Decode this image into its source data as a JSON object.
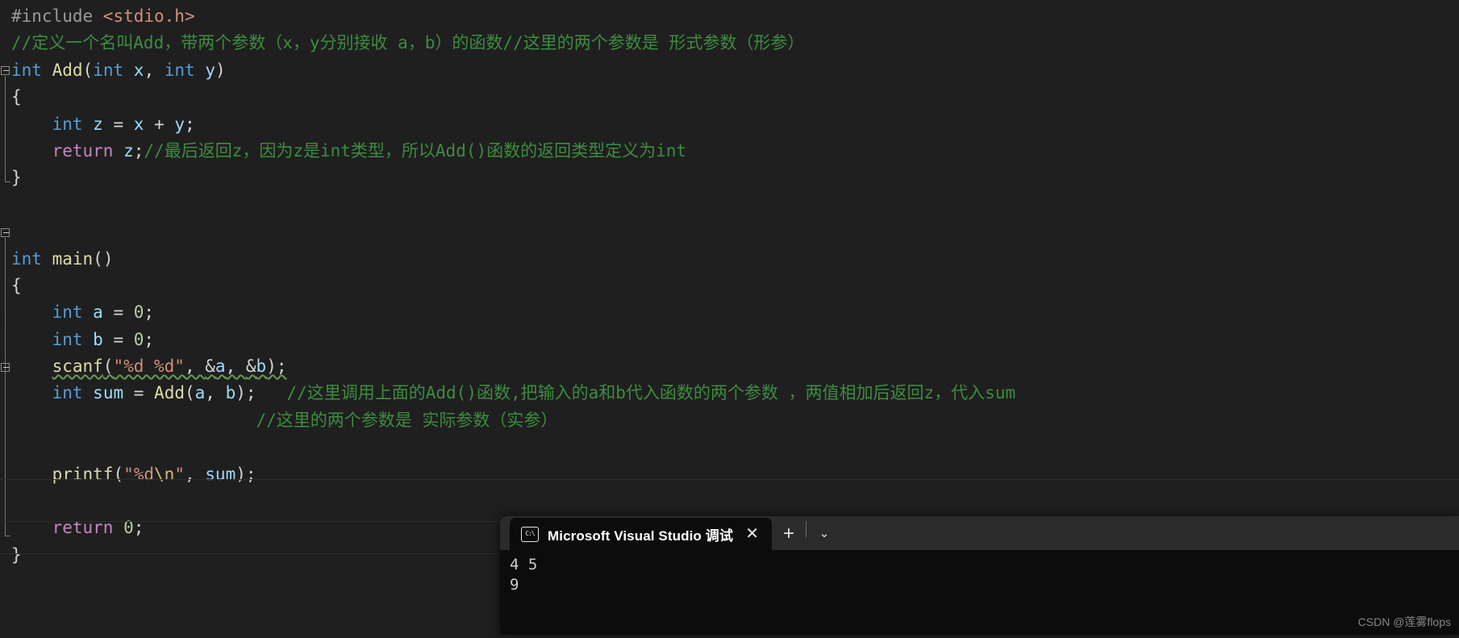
{
  "editor": {
    "background": "#1f1f1f",
    "font_size_px": 21,
    "colors": {
      "preprocessor": "#9b9b9b",
      "header": "#ce9178",
      "keyword": "#569cd6",
      "control_keyword": "#c586c0",
      "function": "#dcdcaa",
      "variable": "#9cdcfe",
      "number": "#b5cea8",
      "string": "#ce9178",
      "escape": "#d7ba7d",
      "comment": "#3d8c40",
      "default": "#d4d4d4",
      "squiggle": "#6a9a55"
    },
    "lines": [
      {
        "id": 1,
        "tokens": [
          {
            "t": "#include ",
            "c": "pre"
          },
          {
            "t": "<stdio.h>",
            "c": "hdr"
          }
        ]
      },
      {
        "id": 2,
        "tokens": [
          {
            "t": "//定义一个名叫Add，带两个参数（x，y分别接收 a，b）的函数//这里的两个参数是 形式参数（形参）",
            "c": "cmt"
          }
        ]
      },
      {
        "id": 3,
        "tokens": [
          {
            "t": "int",
            "c": "kw"
          },
          {
            "t": " ",
            "c": "punc"
          },
          {
            "t": "Add",
            "c": "fn"
          },
          {
            "t": "(",
            "c": "punc"
          },
          {
            "t": "int",
            "c": "kw"
          },
          {
            "t": " ",
            "c": "punc"
          },
          {
            "t": "x",
            "c": "var"
          },
          {
            "t": ", ",
            "c": "punc"
          },
          {
            "t": "int",
            "c": "kw"
          },
          {
            "t": " ",
            "c": "punc"
          },
          {
            "t": "y",
            "c": "var"
          },
          {
            "t": ")",
            "c": "punc"
          }
        ]
      },
      {
        "id": 4,
        "tokens": [
          {
            "t": "{",
            "c": "brace"
          }
        ]
      },
      {
        "id": 5,
        "tokens": [
          {
            "t": "    ",
            "c": "punc"
          },
          {
            "t": "int",
            "c": "kw"
          },
          {
            "t": " ",
            "c": "punc"
          },
          {
            "t": "z",
            "c": "var"
          },
          {
            "t": " = ",
            "c": "punc"
          },
          {
            "t": "x",
            "c": "var"
          },
          {
            "t": " + ",
            "c": "punc"
          },
          {
            "t": "y",
            "c": "var"
          },
          {
            "t": ";",
            "c": "punc"
          }
        ]
      },
      {
        "id": 6,
        "tokens": [
          {
            "t": "    ",
            "c": "punc"
          },
          {
            "t": "return",
            "c": "kwctl"
          },
          {
            "t": " ",
            "c": "punc"
          },
          {
            "t": "z",
            "c": "var"
          },
          {
            "t": ";",
            "c": "punc"
          },
          {
            "t": "//最后返回z，因为z是int类型，所以Add()函数的返回类型定义为int",
            "c": "cmt"
          }
        ]
      },
      {
        "id": 7,
        "tokens": [
          {
            "t": "}",
            "c": "brace"
          }
        ]
      },
      {
        "id": 8,
        "tokens": [
          {
            "t": "",
            "c": "punc"
          }
        ]
      },
      {
        "id": 9,
        "tokens": [
          {
            "t": "",
            "c": "punc"
          }
        ]
      },
      {
        "id": 10,
        "tokens": [
          {
            "t": "int",
            "c": "kw"
          },
          {
            "t": " ",
            "c": "punc"
          },
          {
            "t": "main",
            "c": "fn"
          },
          {
            "t": "()",
            "c": "punc"
          }
        ]
      },
      {
        "id": 11,
        "tokens": [
          {
            "t": "{",
            "c": "brace"
          }
        ]
      },
      {
        "id": 12,
        "tokens": [
          {
            "t": "    ",
            "c": "punc"
          },
          {
            "t": "int",
            "c": "kw"
          },
          {
            "t": " ",
            "c": "punc"
          },
          {
            "t": "a",
            "c": "var"
          },
          {
            "t": " = ",
            "c": "punc"
          },
          {
            "t": "0",
            "c": "num"
          },
          {
            "t": ";",
            "c": "punc"
          }
        ]
      },
      {
        "id": 13,
        "tokens": [
          {
            "t": "    ",
            "c": "punc"
          },
          {
            "t": "int",
            "c": "kw"
          },
          {
            "t": " ",
            "c": "punc"
          },
          {
            "t": "b",
            "c": "var"
          },
          {
            "t": " = ",
            "c": "punc"
          },
          {
            "t": "0",
            "c": "num"
          },
          {
            "t": ";",
            "c": "punc"
          }
        ]
      },
      {
        "id": 14,
        "squiggle_from": 4,
        "tokens": [
          {
            "t": "    ",
            "c": "punc"
          },
          {
            "t": "scanf",
            "c": "fn"
          },
          {
            "t": "(",
            "c": "punc"
          },
          {
            "t": "\"%d %d\"",
            "c": "str"
          },
          {
            "t": ", ",
            "c": "punc"
          },
          {
            "t": "&",
            "c": "punc"
          },
          {
            "t": "a",
            "c": "var"
          },
          {
            "t": ", ",
            "c": "punc"
          },
          {
            "t": "&",
            "c": "punc"
          },
          {
            "t": "b",
            "c": "var"
          },
          {
            "t": ");",
            "c": "punc"
          }
        ]
      },
      {
        "id": 15,
        "tokens": [
          {
            "t": "    ",
            "c": "punc"
          },
          {
            "t": "int",
            "c": "kw"
          },
          {
            "t": " ",
            "c": "punc"
          },
          {
            "t": "sum",
            "c": "var"
          },
          {
            "t": " = ",
            "c": "punc"
          },
          {
            "t": "Add",
            "c": "fn"
          },
          {
            "t": "(",
            "c": "punc"
          },
          {
            "t": "a",
            "c": "var"
          },
          {
            "t": ", ",
            "c": "punc"
          },
          {
            "t": "b",
            "c": "var"
          },
          {
            "t": ");   ",
            "c": "punc"
          },
          {
            "t": "//这里调用上面的Add()函数,把输入的a和b代入函数的两个参数 ，两值相加后返回z，代入sum",
            "c": "cmt"
          }
        ]
      },
      {
        "id": 16,
        "tokens": [
          {
            "t": "                        ",
            "c": "punc"
          },
          {
            "t": "//这里的两个参数是 实际参数（实参）",
            "c": "cmt"
          }
        ]
      },
      {
        "id": 17,
        "tokens": [
          {
            "t": "",
            "c": "punc"
          }
        ]
      },
      {
        "id": 18,
        "tokens": [
          {
            "t": "    ",
            "c": "punc"
          },
          {
            "t": "printf",
            "c": "fn"
          },
          {
            "t": "(",
            "c": "punc"
          },
          {
            "t": "\"%d",
            "c": "str"
          },
          {
            "t": "\\n",
            "c": "esc"
          },
          {
            "t": "\"",
            "c": "str"
          },
          {
            "t": ", ",
            "c": "punc"
          },
          {
            "t": "sum",
            "c": "var"
          },
          {
            "t": ");",
            "c": "punc"
          }
        ]
      },
      {
        "id": 19,
        "tokens": [
          {
            "t": "",
            "c": "punc"
          }
        ]
      },
      {
        "id": 20,
        "tokens": [
          {
            "t": "    ",
            "c": "punc"
          },
          {
            "t": "return",
            "c": "kwctl"
          },
          {
            "t": " ",
            "c": "punc"
          },
          {
            "t": "0",
            "c": "num"
          },
          {
            "t": ";",
            "c": "punc"
          }
        ]
      },
      {
        "id": 21,
        "tokens": [
          {
            "t": "}",
            "c": "brace"
          }
        ]
      }
    ]
  },
  "terminal": {
    "tab": {
      "icon": "cmd-prompt-icon",
      "icon_text": "C:\\",
      "title": "Microsoft Visual Studio 调试控",
      "close_label": "✕"
    },
    "new_tab_label": "+",
    "dropdown_label": "⌄",
    "output_lines": [
      "4 5",
      "9"
    ]
  },
  "watermark": {
    "text": "CSDN @莲雾flops"
  }
}
